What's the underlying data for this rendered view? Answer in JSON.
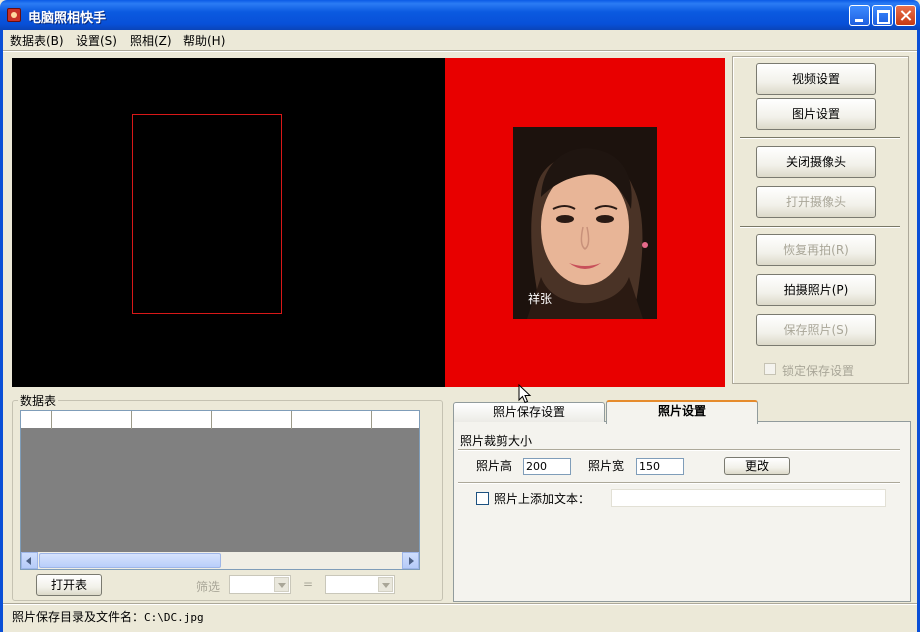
{
  "window": {
    "title": "电脑照相快手"
  },
  "menu": [
    {
      "label": "数据表(B)"
    },
    {
      "label": "设置(S)"
    },
    {
      "label": "照相(Z)"
    },
    {
      "label": "帮助(H)"
    }
  ],
  "preview": {
    "photo_label": "祥张"
  },
  "buttons": {
    "video_settings": "视频设置",
    "image_settings": "图片设置",
    "close_camera": "关闭摄像头",
    "open_camera": "打开摄像头",
    "retake": "恢复再拍(R)",
    "take_photo": "拍摄照片(P)",
    "save_photo": "保存照片(S)",
    "lock_save": "锁定保存设置"
  },
  "table": {
    "legend": "数据表",
    "open_button": "打开表",
    "filter_label": "筛选",
    "equals": "="
  },
  "tabs": [
    {
      "label": "照片保存设置"
    },
    {
      "label": "照片设置"
    }
  ],
  "photo_settings": {
    "crop_label": "照片裁剪大小",
    "height_label": "照片高",
    "height_value": "200",
    "width_label": "照片宽",
    "width_value": "150",
    "change_button": "更改",
    "add_text_label": "照片上添加文本：",
    "add_text_value": ""
  },
  "status": {
    "label": "照片保存目录及文件名：",
    "path": "C:\\DC.jpg"
  },
  "colors": {
    "preview_black": "#000000",
    "preview_red": "#e80000",
    "crop_box": "#d81818",
    "grid_bg": "#808080",
    "titlebar": "#0a5ae6"
  }
}
